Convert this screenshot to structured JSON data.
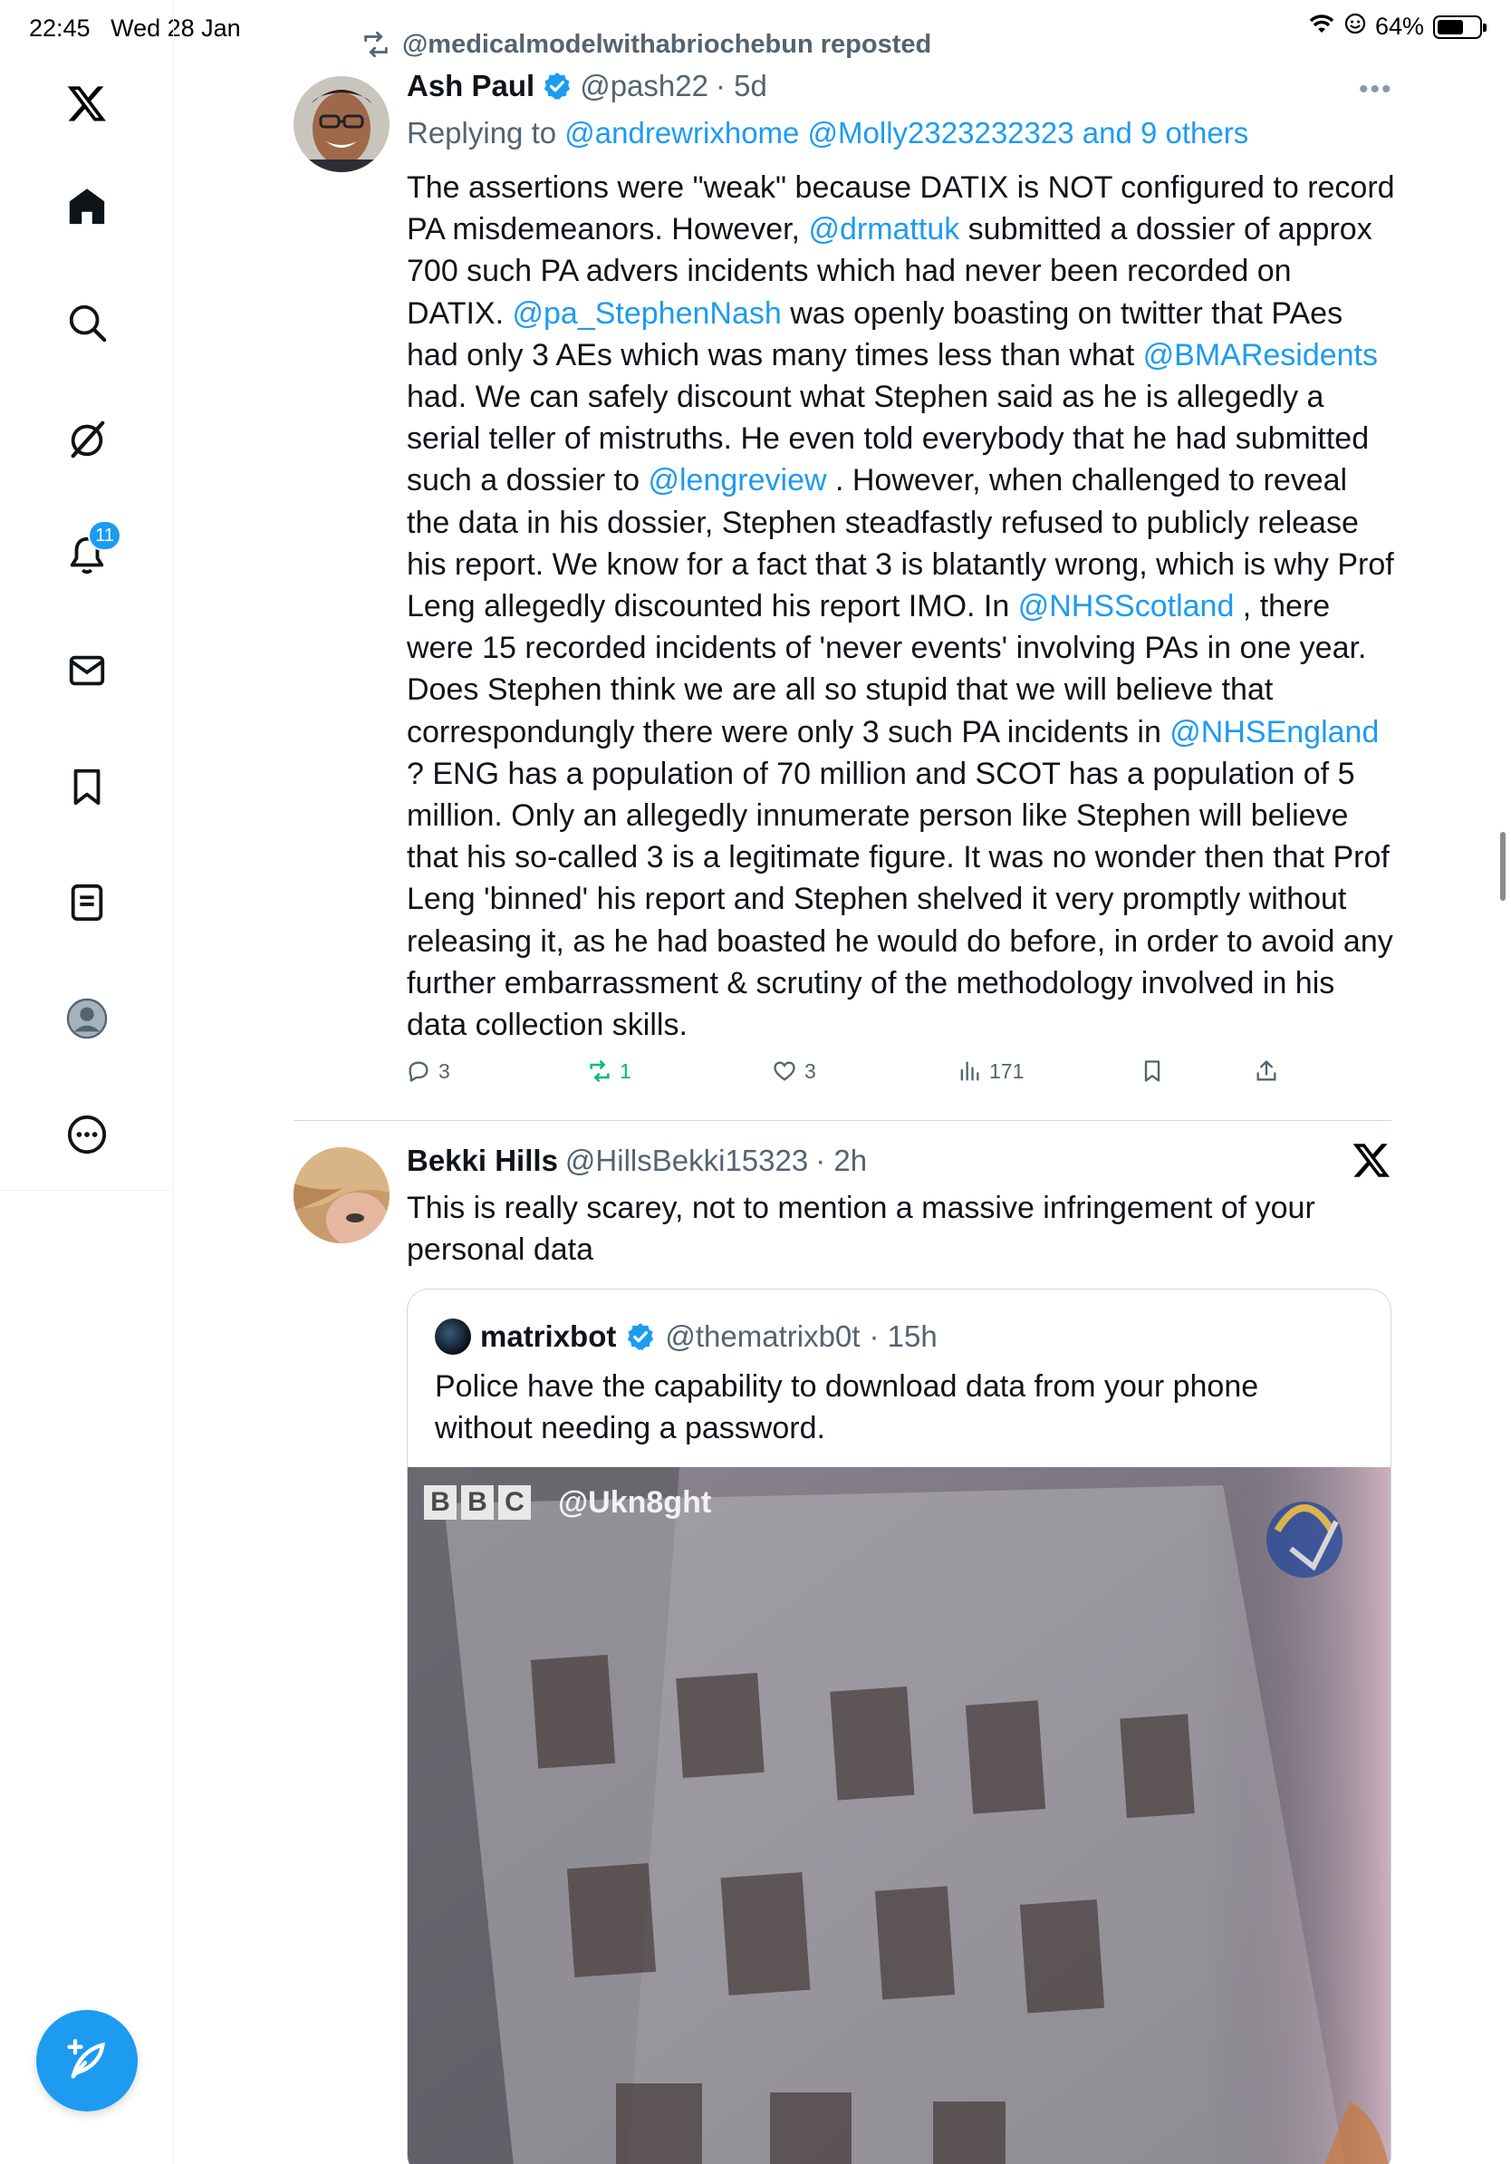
{
  "status_bar": {
    "time": "22:45",
    "date": "Wed 28 Jan",
    "battery": "64%",
    "battery_level": 0.64
  },
  "sidebar": {
    "items": [
      {
        "icon": "x-logo-icon"
      },
      {
        "icon": "home-icon"
      },
      {
        "icon": "search-icon"
      },
      {
        "icon": "grok-icon"
      },
      {
        "icon": "notifications-icon",
        "badge": "11"
      },
      {
        "icon": "messages-icon"
      },
      {
        "icon": "bookmarks-icon"
      },
      {
        "icon": "lists-icon"
      },
      {
        "icon": "profile-icon"
      },
      {
        "icon": "more-icon"
      }
    ],
    "compose_icon": "compose-icon"
  },
  "colors": {
    "accent": "#1d9bf0",
    "text": "#0f1419",
    "secondary": "#536471",
    "retweet_green": "#00ba7c"
  },
  "tweet1": {
    "repost_text": "@medicalmodelwithabriochebun reposted",
    "name": "Ash Paul",
    "handle": "@pash22",
    "time": "· 5d",
    "reply_prefix": "Replying to",
    "reply_targets": "@andrewrixhome @Molly2323232323 and 9 others",
    "body": {
      "p1": "The assertions were \"weak\" because DATIX is NOT configured to record PA misdemeanors. However, ",
      "m1": "@drmattuk",
      "p2": " submitted a dossier of approx 700 such PA advers incidents which had never been recorded on DATIX. ",
      "m2": "@pa_StephenNash",
      "p3": " was openly boasting on twitter that PAes had only 3 AEs which was many times less than what ",
      "m3": "@BMAResidents",
      "p4": " had. We can safely discount what Stephen said as he is allegedly a serial teller of mistruths. He even told everybody that he had submitted such a dossier to ",
      "m4": "@lengreview",
      "p5": " . However, when challenged to reveal the data in his dossier, Stephen steadfastly refused to publicly release his report. We know for a fact that 3 is blatantly wrong, which is why Prof Leng allegedly discounted his report IMO. In ",
      "m5": "@NHSScotland",
      "p6": " , there were 15 recorded incidents of 'never events' involving PAs in one year. Does Stephen think we are all so stupid that we will believe that correspondungly there were only 3 such PA incidents in ",
      "m6": "@NHSEngland",
      "p7": " ? ENG has a population of 70 million and SCOT has a population of 5 million. Only an allegedly innumerate person like Stephen will believe that his so-called 3 is a legitimate figure. It was no wonder then that Prof Leng 'binned' his report and Stephen shelved it very promptly without releasing it, as he had boasted he would do before, in order to avoid any further embarrassment & scrutiny of the methodology involved in his data collection skills."
    },
    "actions": {
      "replies": "3",
      "reposts": "1",
      "likes": "3",
      "views": "171"
    }
  },
  "tweet2": {
    "name": "Bekki Hills",
    "handle": "@HillsBekki15323",
    "time": "· 2h",
    "body": "This is really scarey, not to mention a massive infringement of your personal data",
    "quote": {
      "name": "matrixbot",
      "handle": "@thematrixb0t",
      "time": "· 15h",
      "body": "Police have the capability to download data from your phone without needing a password.",
      "media_logo": [
        "B",
        "B",
        "C"
      ],
      "media_handle": "@Ukn8ght"
    }
  }
}
